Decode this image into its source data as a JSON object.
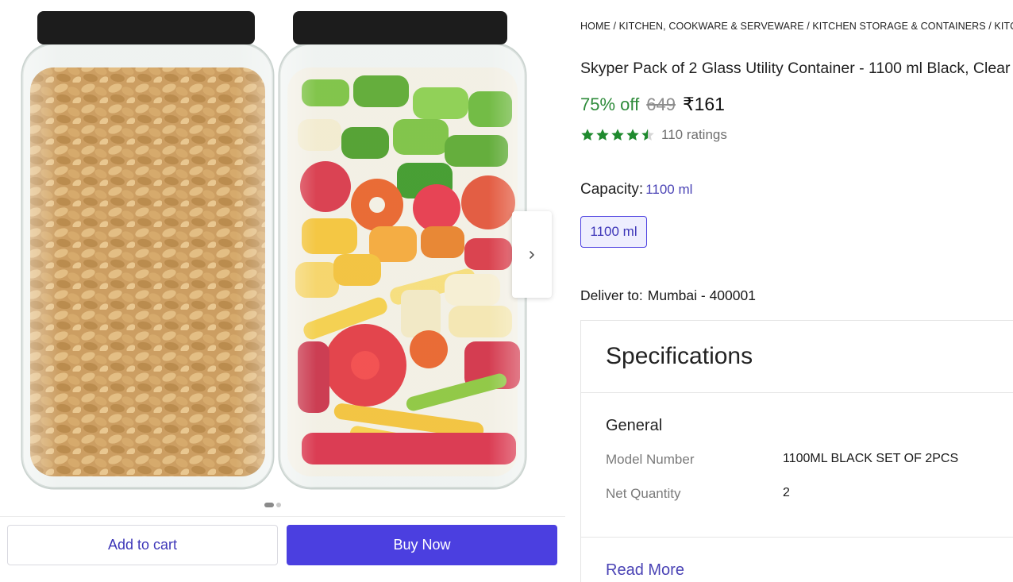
{
  "gallery": {
    "image_description": "two-glass-jars-raisins-and-pasta",
    "next_icon": "chevron-right-icon",
    "dots": [
      true,
      false
    ]
  },
  "actions": {
    "add_to_cart": "Add to cart",
    "buy_now": "Buy Now"
  },
  "breadcrumb": "HOME / KITCHEN, COOKWARE & SERVEWARE / KITCHEN STORAGE & CONTAINERS / KITCHEN",
  "product": {
    "title": "Skyper Pack of 2 Glass Utility Container  - 1100 ml Black, Clear",
    "discount": "75% off",
    "mrp": "649",
    "price": "₹161",
    "rating_value": 4.5,
    "ratings_count": "110 ratings"
  },
  "capacity": {
    "label": "Capacity:",
    "selected": "1100 ml",
    "option": "1100 ml"
  },
  "delivery": {
    "label": "Deliver to:",
    "location": "Mumbai - 400001"
  },
  "specifications": {
    "title": "Specifications",
    "section": "General",
    "rows": [
      {
        "key": "Model Number",
        "value": "1100ML BLACK SET OF 2PCS"
      },
      {
        "key": "Net Quantity",
        "value": "2"
      }
    ],
    "read_more": "Read More"
  },
  "colors": {
    "accent": "#4b3fe0",
    "discount_green": "#2e8b3a",
    "star_green": "#1f8a2e"
  }
}
